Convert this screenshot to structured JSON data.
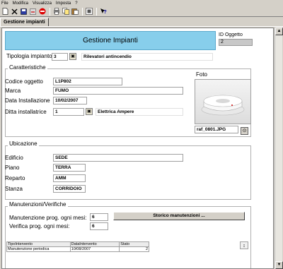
{
  "menubar": [
    "File",
    "Modifica",
    "Visualizza",
    "Imposta",
    "?"
  ],
  "toolbar": {
    "icons": [
      "new-doc-icon",
      "delete-icon",
      "save-icon",
      "undo-icon",
      "stop-icon",
      "print-icon",
      "copy-icon",
      "paste-icon",
      "record-icon",
      "help-icon"
    ]
  },
  "tab": {
    "label": "Gestione impianti"
  },
  "banner": {
    "title": "Gestione Impianti"
  },
  "id_oggetto": {
    "label": "ID Oggetto",
    "value": "2"
  },
  "tipologia": {
    "label": "Tipologia impianto",
    "code": "3",
    "description": "Rilevatori antincendio"
  },
  "caratteristiche": {
    "title": "Caratteristiche",
    "codice_label": "Codice oggetto",
    "codice_value": "L1P802",
    "marca_label": "Marca",
    "marca_value": "FUMO",
    "data_label": "Data Installazione",
    "data_value": "10/02/2007",
    "ditta_label": "Ditta installatrice",
    "ditta_code": "1",
    "ditta_name": "Elettrica Ampere"
  },
  "foto": {
    "label": "Foto",
    "filename": "raf_0801.JPG"
  },
  "ubicazione": {
    "title": "Ubicazione",
    "edificio_label": "Edificio",
    "edificio_value": "SEDE",
    "piano_label": "Piano",
    "piano_value": "TERRA",
    "reparto_label": "Reparto",
    "reparto_value": "AMM",
    "stanza_label": "Stanza",
    "stanza_value": "CORRIDOIO"
  },
  "manutenzioni": {
    "title": "Manutenzioni/Verifiche",
    "manut_label": "Manutenzione prog. ogni mesi:",
    "manut_value": "6",
    "verif_label": "Verifica prog. ogni mesi:",
    "verif_value": "6",
    "storico_button": "Storico manutenzioni ...",
    "table": {
      "headers": [
        "TipoIntervento",
        "DataIntervento",
        "Stato"
      ],
      "rows": [
        [
          "Manutenzione periodica",
          "10/08/2007",
          "2"
        ]
      ]
    }
  }
}
